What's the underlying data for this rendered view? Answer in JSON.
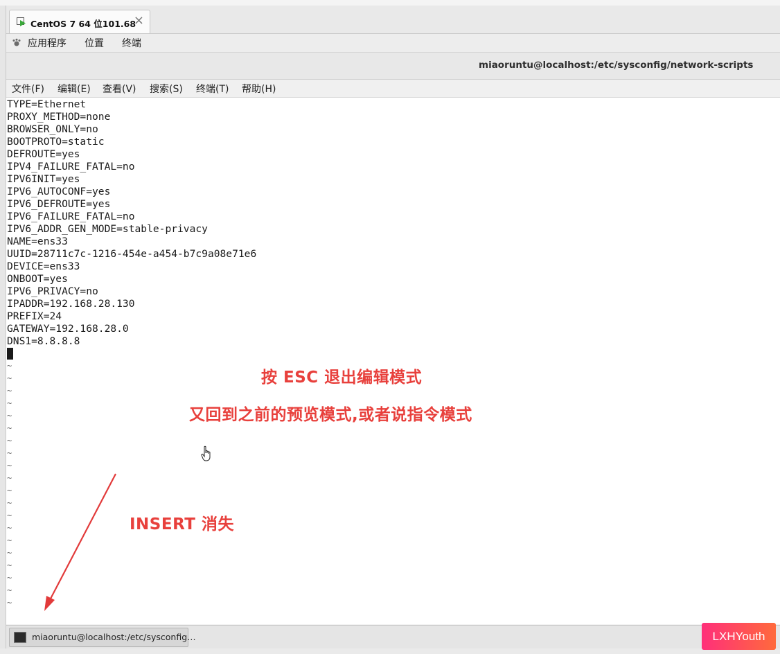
{
  "vm_tab": {
    "label": "CentOS 7 64 位101.68",
    "close": "×"
  },
  "gnome_menu": [
    "应用程序",
    "位置",
    "终端"
  ],
  "window_title": "miaoruntu@localhost:/etc/sysconfig/network-scripts",
  "terminal_menu": [
    "文件(F)",
    "编辑(E)",
    "查看(V)",
    "搜索(S)",
    "终端(T)",
    "帮助(H)"
  ],
  "file_lines": [
    "TYPE=Ethernet",
    "PROXY_METHOD=none",
    "BROWSER_ONLY=no",
    "BOOTPROTO=static",
    "DEFROUTE=yes",
    "IPV4_FAILURE_FATAL=no",
    "IPV6INIT=yes",
    "IPV6_AUTOCONF=yes",
    "IPV6_DEFROUTE=yes",
    "IPV6_FAILURE_FATAL=no",
    "IPV6_ADDR_GEN_MODE=stable-privacy",
    "NAME=ens33",
    "UUID=28711c7c-1216-454e-a454-b7c9a08e71e6",
    "DEVICE=ens33",
    "ONBOOT=yes",
    "IPV6_PRIVACY=no",
    "IPADDR=192.168.28.130",
    "PREFIX=24",
    "GATEWAY=192.168.28.0",
    "DNS1=8.8.8.8"
  ],
  "empty_line_marker": "~",
  "empty_line_count": 20,
  "annotations": {
    "esc_note": "按 ESC 退出编辑模式",
    "mode_note": "又回到之前的预览模式,或者说指令模式",
    "insert_note": "INSERT 消失"
  },
  "taskbar": {
    "item_label": "miaoruntu@localhost:/etc/sysconfig…"
  },
  "watermark": "LXHYouth",
  "colors": {
    "annotation": "#e8403c",
    "watermark_start": "#ff2f7a",
    "watermark_end": "#ff6a3c"
  },
  "icons": {
    "vm_tab": "vm-play-icon",
    "apps": "apps-foot-icon",
    "task": "terminal-icon",
    "pointer": "hand-pointer-icon"
  }
}
